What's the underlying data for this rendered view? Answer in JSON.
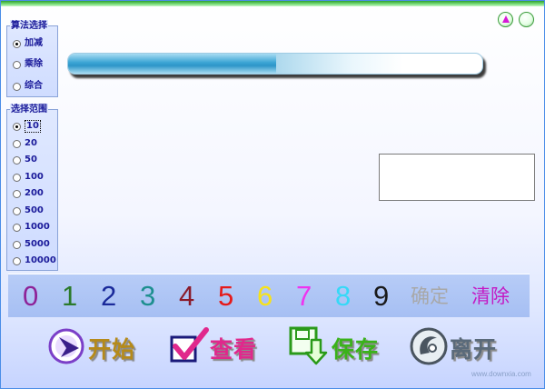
{
  "window": {
    "minimize_icon": "triangle-icon",
    "close_icon": "circle-icon"
  },
  "algorithm_group": {
    "title": "算法选择",
    "options": [
      {
        "label": "加减",
        "checked": true
      },
      {
        "label": "乘除",
        "checked": false
      },
      {
        "label": "综合",
        "checked": false
      }
    ]
  },
  "range_group": {
    "title": "选择范围",
    "options": [
      {
        "label": "10",
        "checked": true
      },
      {
        "label": "20",
        "checked": false
      },
      {
        "label": "50",
        "checked": false
      },
      {
        "label": "100",
        "checked": false
      },
      {
        "label": "200",
        "checked": false
      },
      {
        "label": "500",
        "checked": false
      },
      {
        "label": "1000",
        "checked": false
      },
      {
        "label": "5000",
        "checked": false
      },
      {
        "label": "10000",
        "checked": false
      }
    ]
  },
  "progress": {
    "value": 0.5
  },
  "keypad": {
    "digits": [
      {
        "label": "0",
        "color": "#8e2398"
      },
      {
        "label": "1",
        "color": "#2b7a2b"
      },
      {
        "label": "2",
        "color": "#1a2a9a"
      },
      {
        "label": "3",
        "color": "#1d8f8f"
      },
      {
        "label": "4",
        "color": "#8a1a2a"
      },
      {
        "label": "5",
        "color": "#e61a1a"
      },
      {
        "label": "6",
        "color": "#f7e21a"
      },
      {
        "label": "7",
        "color": "#ef34ef"
      },
      {
        "label": "8",
        "color": "#36d9f7"
      },
      {
        "label": "9",
        "color": "#1a1a1a"
      }
    ],
    "confirm": {
      "label": "确定",
      "color": "#a8a8a8"
    },
    "clear": {
      "label": "清除",
      "color": "#c41ac4"
    }
  },
  "actions": {
    "start": {
      "label": "开始",
      "color": "#b58a1a",
      "icon": "play-arrow-icon"
    },
    "view": {
      "label": "查看",
      "color": "#e0288c",
      "icon": "checkmark-icon"
    },
    "save": {
      "label": "保存",
      "color": "#3ab21a",
      "icon": "save-disk-icon"
    },
    "exit": {
      "label": "离开",
      "color": "#5a6a7a",
      "icon": "exit-swirl-icon"
    }
  },
  "watermark": "www.downxia.com"
}
